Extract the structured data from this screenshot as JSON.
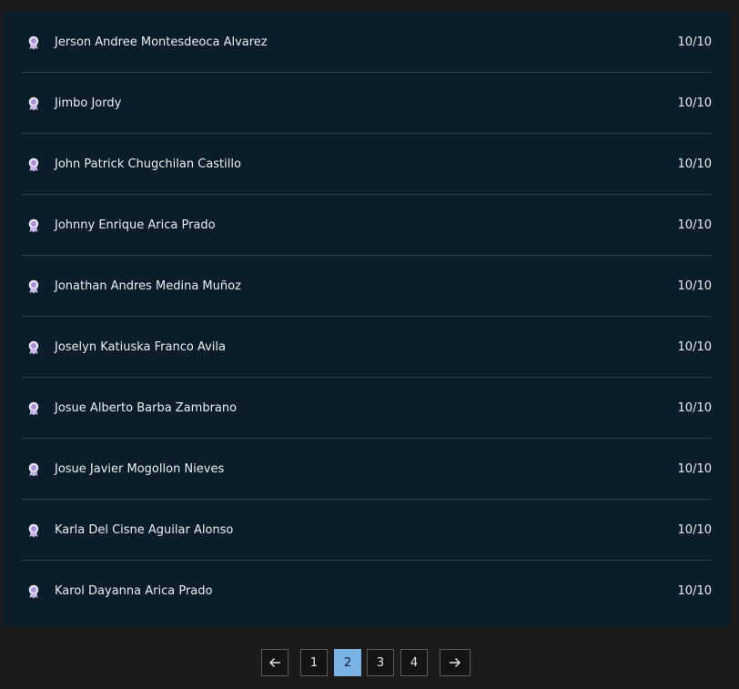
{
  "rows": [
    {
      "name": "Jerson Andree Montesdeoca Alvarez",
      "score": "10/10"
    },
    {
      "name": "Jimbo Jordy",
      "score": "10/10"
    },
    {
      "name": "John Patrick Chugchilan Castillo",
      "score": "10/10"
    },
    {
      "name": "Johnny Enrique Arica Prado",
      "score": "10/10"
    },
    {
      "name": "Jonathan Andres Medina Muñoz",
      "score": "10/10"
    },
    {
      "name": "Joselyn Katiuska Franco Avila",
      "score": "10/10"
    },
    {
      "name": "Josue Alberto Barba Zambrano",
      "score": "10/10"
    },
    {
      "name": "Josue Javier Mogollon Nieves",
      "score": "10/10"
    },
    {
      "name": "Karla Del Cisne Aguilar Alonso",
      "score": "10/10"
    },
    {
      "name": "Karol Dayanna Arica Prado",
      "score": "10/10"
    }
  ],
  "pagination": {
    "prev_icon": "arrow-left-icon",
    "next_icon": "arrow-right-icon",
    "pages": [
      "1",
      "2",
      "3",
      "4"
    ],
    "current": "2"
  },
  "colors": {
    "background": "#1b1b1b",
    "panel": "#0b1d29",
    "divider": "#2c3c48",
    "active_page": "#7ab3e6"
  }
}
